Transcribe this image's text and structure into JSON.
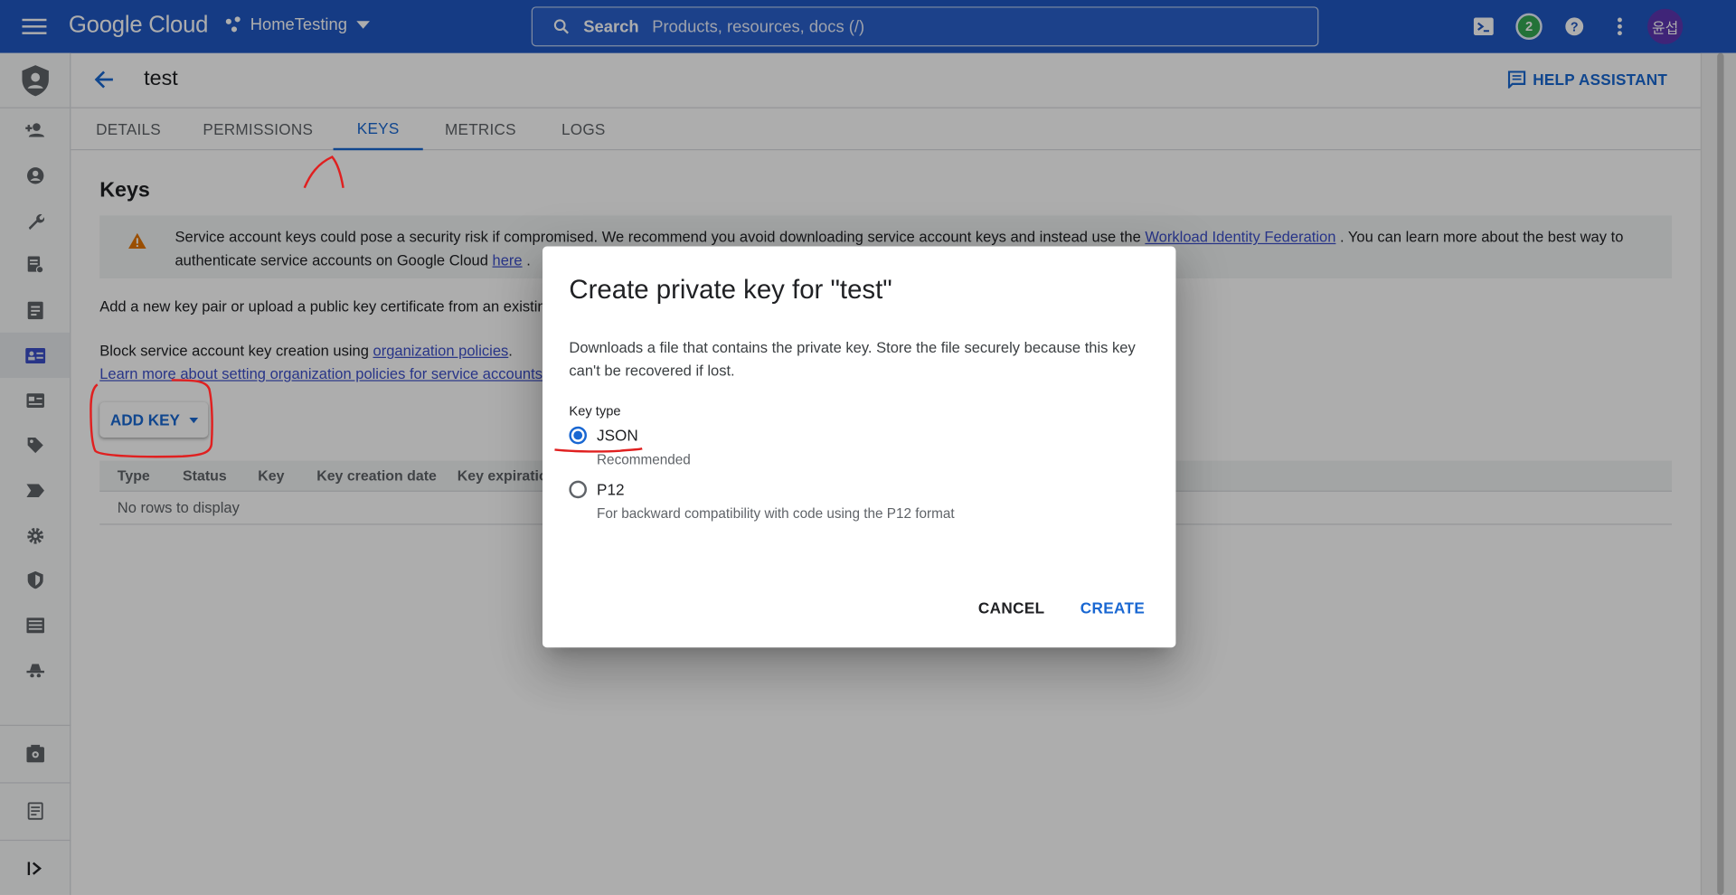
{
  "topbar": {
    "logo": "Google Cloud",
    "project": "HomeTesting",
    "search_label": "Search",
    "search_placeholder": "Products, resources, docs (/)",
    "notification_count": "2",
    "avatar_text": "윤섭"
  },
  "header": {
    "title": "test",
    "help_assistant": "HELP ASSISTANT"
  },
  "tabs": [
    {
      "label": "DETAILS"
    },
    {
      "label": "PERMISSIONS"
    },
    {
      "label": "KEYS",
      "active": true
    },
    {
      "label": "METRICS"
    },
    {
      "label": "LOGS"
    }
  ],
  "main": {
    "heading": "Keys",
    "warning": {
      "text_before": "Service account keys could pose a security risk if compromised. We recommend you avoid downloading service account keys and instead use the ",
      "link1": "Workload Identity Federation",
      "text_middle": " . You can learn more about the best way to authenticate service accounts on Google Cloud ",
      "link2": "here",
      "text_after": " ."
    },
    "add_pair_text": "Add a new key pair or upload a public key certificate from an existing",
    "block_text": "Block service account key creation using ",
    "block_link": "organization policies",
    "block_after": ".",
    "learn_more_link": "Learn more about setting organization policies for service accounts",
    "add_key_button": "ADD KEY",
    "table": {
      "columns": [
        "Type",
        "Status",
        "Key",
        "Key creation date",
        "Key expiration"
      ],
      "empty_text": "No rows to display"
    }
  },
  "dialog": {
    "title": "Create private key for \"test\"",
    "description": "Downloads a file that contains the private key. Store the file securely because this key can't be recovered if lost.",
    "key_type_label": "Key type",
    "options": [
      {
        "label": "JSON",
        "sub": "Recommended",
        "selected": true
      },
      {
        "label": "P12",
        "sub": "For backward compatibility with code using the P12 format",
        "selected": false
      }
    ],
    "cancel_label": "CANCEL",
    "create_label": "CREATE"
  },
  "colors": {
    "topbar": "#1f57c3",
    "accent": "#1967d2",
    "annotation": "#e02020"
  }
}
